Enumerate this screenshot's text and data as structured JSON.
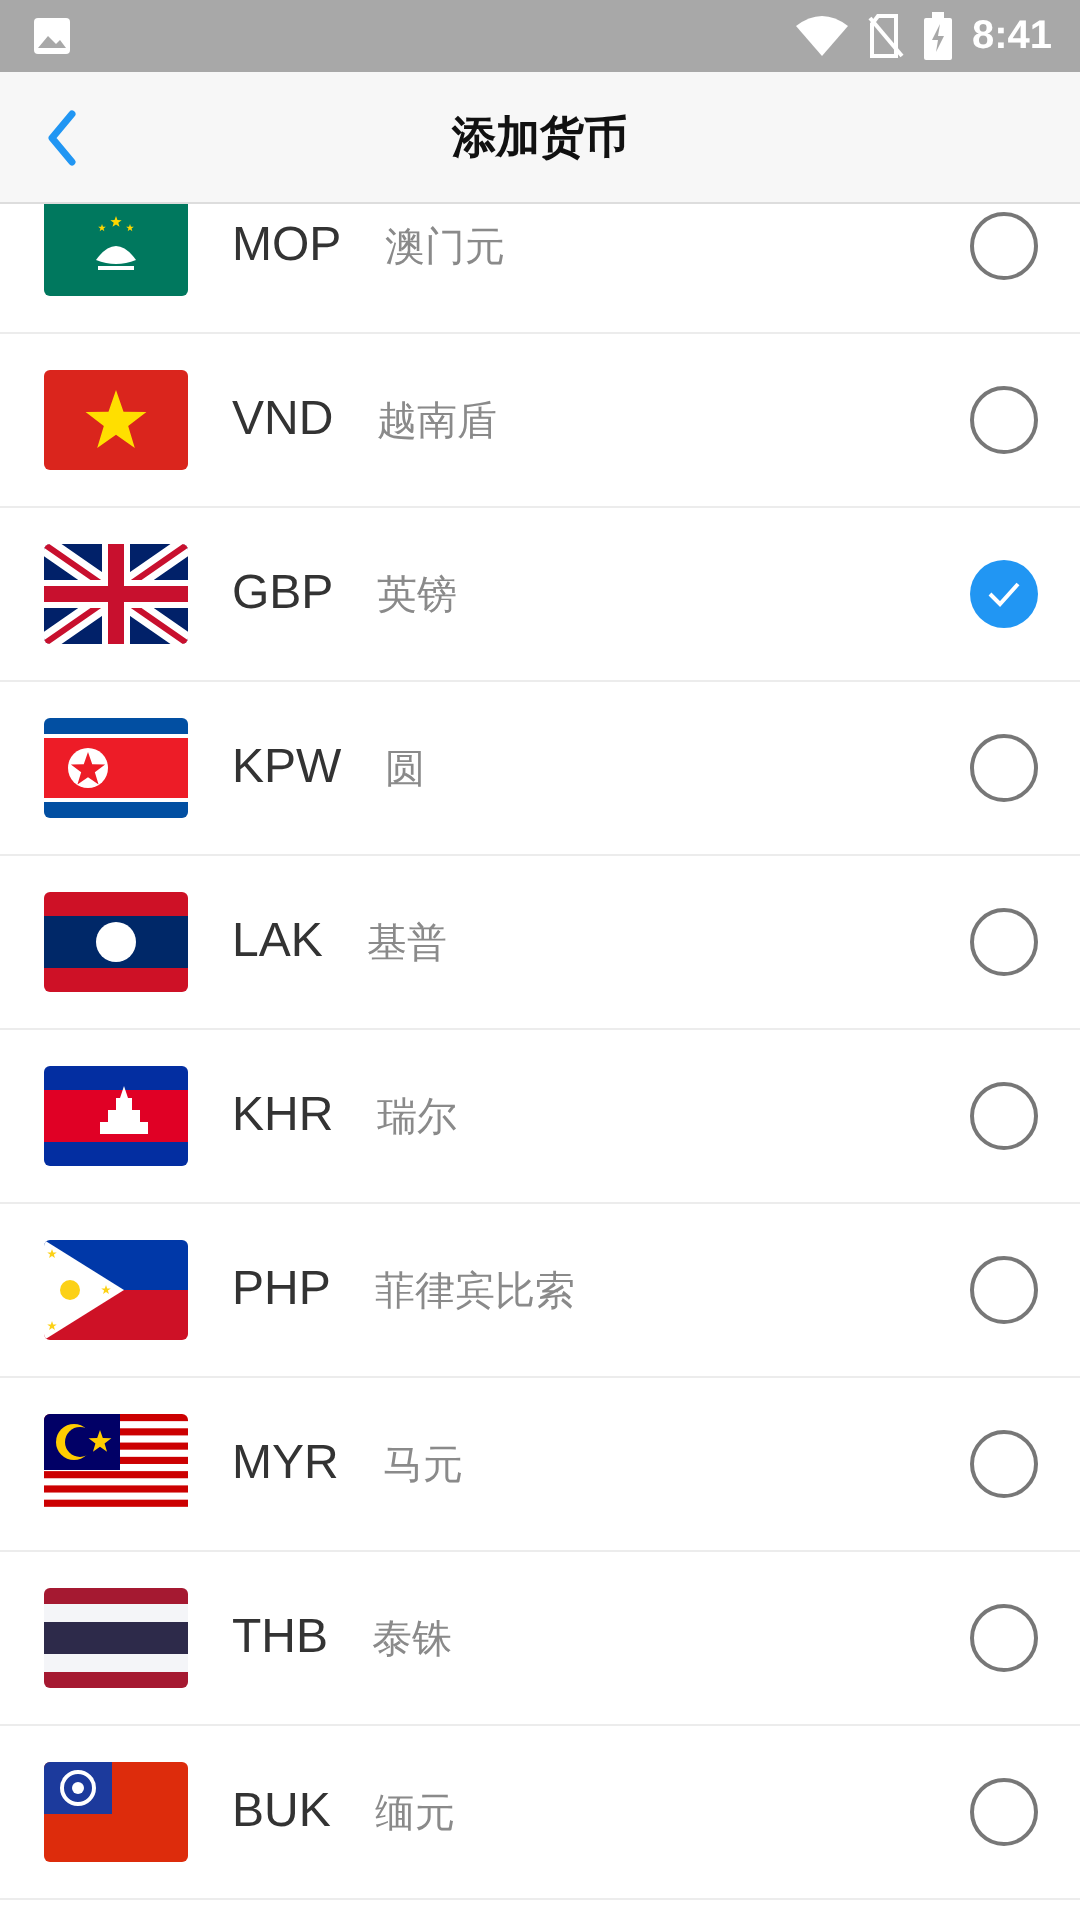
{
  "status_bar": {
    "time": "8:41"
  },
  "header": {
    "title": "添加货币"
  },
  "currencies": [
    {
      "code": "MOP",
      "name": "澳门元",
      "kind": "mo",
      "selected": false
    },
    {
      "code": "VND",
      "name": "越南盾",
      "kind": "vn",
      "selected": false
    },
    {
      "code": "GBP",
      "name": "英镑",
      "kind": "gb",
      "selected": true
    },
    {
      "code": "KPW",
      "name": "圆",
      "kind": "kp",
      "selected": false
    },
    {
      "code": "LAK",
      "name": "基普",
      "kind": "la",
      "selected": false
    },
    {
      "code": "KHR",
      "name": "瑞尔",
      "kind": "kh",
      "selected": false
    },
    {
      "code": "PHP",
      "name": "菲律宾比索",
      "kind": "ph",
      "selected": false
    },
    {
      "code": "MYR",
      "name": "马元",
      "kind": "my",
      "selected": false
    },
    {
      "code": "THB",
      "name": "泰铢",
      "kind": "th",
      "selected": false
    },
    {
      "code": "BUK",
      "name": "缅元",
      "kind": "mm",
      "selected": false
    }
  ]
}
